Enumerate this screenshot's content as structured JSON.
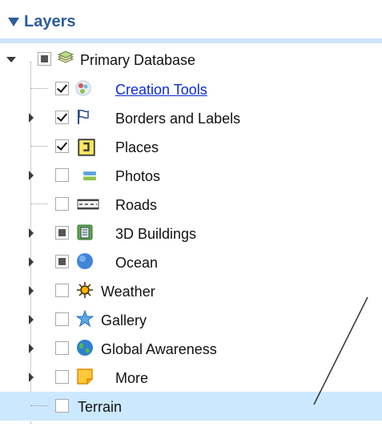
{
  "panel": {
    "title": "Layers"
  },
  "layers": {
    "root": {
      "label": "Primary Database",
      "icon": "database-layers-icon"
    },
    "creation_tools": {
      "label": "Creation Tools",
      "icon": "creation-tools-icon"
    },
    "borders": {
      "label": "Borders and Labels",
      "icon": "flag-icon"
    },
    "places": {
      "label": "Places",
      "icon": "places-icon"
    },
    "photos": {
      "label": "Photos",
      "icon": "photo-icon"
    },
    "roads": {
      "label": "Roads",
      "icon": "road-icon"
    },
    "buildings": {
      "label": "3D Buildings",
      "icon": "building-icon"
    },
    "ocean": {
      "label": "Ocean",
      "icon": "ocean-globe-icon"
    },
    "weather": {
      "label": "Weather",
      "icon": "sun-icon"
    },
    "gallery": {
      "label": "Gallery",
      "icon": "star-icon"
    },
    "global": {
      "label": "Global Awareness",
      "icon": "earth-icon"
    },
    "more": {
      "label": "More",
      "icon": "sticky-note-icon"
    },
    "terrain": {
      "label": "Terrain",
      "icon": "none"
    }
  },
  "colors": {
    "header_text": "#2c5d9b",
    "selected_row": "#cce8ff",
    "link": "#0a2bd6"
  }
}
